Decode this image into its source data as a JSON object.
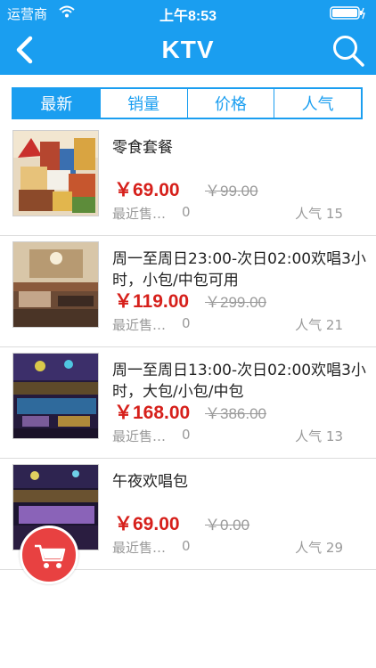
{
  "status_bar": {
    "carrier": "运营商",
    "time": "上午8:53"
  },
  "header": {
    "title": "KTV",
    "back_icon": "back-chevron-icon",
    "search_icon": "search-icon"
  },
  "tabs": [
    {
      "label": "最新",
      "active": true
    },
    {
      "label": "销量",
      "active": false
    },
    {
      "label": "价格",
      "active": false
    },
    {
      "label": "人气",
      "active": false
    }
  ],
  "products": [
    {
      "name": "零食套餐",
      "price": "￥69.00",
      "original_price": "￥99.00",
      "sales_label": "最近售…",
      "sales_count": "0",
      "popularity": "人气 15"
    },
    {
      "name": "周一至周日23:00-次日02:00欢唱3小时，小包/中包可用",
      "price": "￥119.00",
      "original_price": "￥299.00",
      "sales_label": "最近售…",
      "sales_count": "0",
      "popularity": "人气 21"
    },
    {
      "name": "周一至周日13:00-次日02:00欢唱3小时，大包/小包/中包",
      "price": "￥168.00",
      "original_price": "￥386.00",
      "sales_label": "最近售…",
      "sales_count": "0",
      "popularity": "人气 13"
    },
    {
      "name": "午夜欢唱包",
      "price": "￥69.00",
      "original_price": "￥0.00",
      "sales_label": "最近售…",
      "sales_count": "0",
      "popularity": "人气 29"
    }
  ],
  "floating_button": {
    "icon": "shopping-cart-icon"
  },
  "colors": {
    "primary": "#1a9ef0",
    "price": "#d6201b",
    "muted": "#9a9a9a",
    "cart": "#e84141"
  }
}
